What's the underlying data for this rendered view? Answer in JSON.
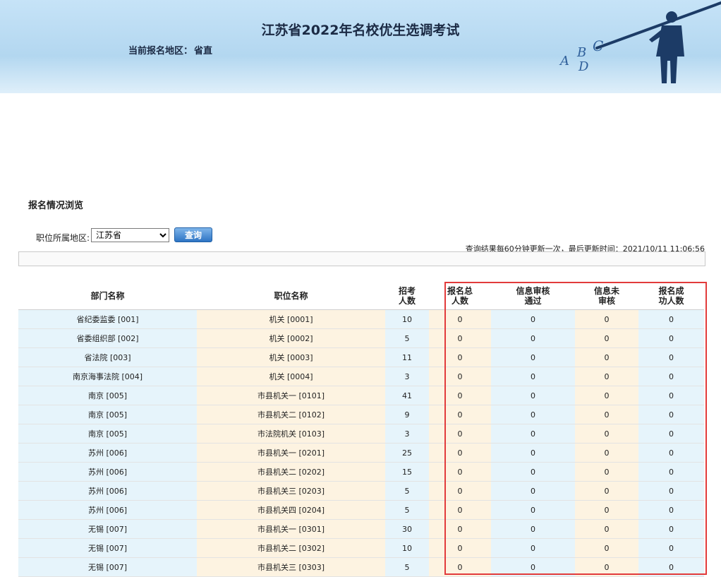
{
  "header": {
    "title": "江苏省2022年名校优生选调考试",
    "region_label": "当前报名地区：",
    "region_value": "省直",
    "art_letters": "A B C D"
  },
  "section_title": "报名情况浏览",
  "filter": {
    "label": "职位所属地区:",
    "selected_value": "江苏省",
    "query_button": "查询"
  },
  "update_note": "查询结果每60分钟更新一次，最后更新时间：2021/10/11 11:06:56",
  "table": {
    "headers": [
      "部门名称",
      "职位名称",
      "招考人数",
      "报名总人数",
      "信息审核通过",
      "信息未审核",
      "报名成功人数"
    ],
    "rows": [
      {
        "dept": "省纪委监委 [001]",
        "position": "机关 [0001]",
        "quota": "10",
        "total": "0",
        "passed": "0",
        "unreviewed": "0",
        "success": "0"
      },
      {
        "dept": "省委组织部 [002]",
        "position": "机关 [0002]",
        "quota": "5",
        "total": "0",
        "passed": "0",
        "unreviewed": "0",
        "success": "0"
      },
      {
        "dept": "省法院 [003]",
        "position": "机关 [0003]",
        "quota": "11",
        "total": "0",
        "passed": "0",
        "unreviewed": "0",
        "success": "0"
      },
      {
        "dept": "南京海事法院 [004]",
        "position": "机关 [0004]",
        "quota": "3",
        "total": "0",
        "passed": "0",
        "unreviewed": "0",
        "success": "0"
      },
      {
        "dept": "南京 [005]",
        "position": "市县机关一 [0101]",
        "quota": "41",
        "total": "0",
        "passed": "0",
        "unreviewed": "0",
        "success": "0"
      },
      {
        "dept": "南京 [005]",
        "position": "市县机关二 [0102]",
        "quota": "9",
        "total": "0",
        "passed": "0",
        "unreviewed": "0",
        "success": "0"
      },
      {
        "dept": "南京 [005]",
        "position": "市法院机关 [0103]",
        "quota": "3",
        "total": "0",
        "passed": "0",
        "unreviewed": "0",
        "success": "0"
      },
      {
        "dept": "苏州 [006]",
        "position": "市县机关一 [0201]",
        "quota": "25",
        "total": "0",
        "passed": "0",
        "unreviewed": "0",
        "success": "0"
      },
      {
        "dept": "苏州 [006]",
        "position": "市县机关二 [0202]",
        "quota": "15",
        "total": "0",
        "passed": "0",
        "unreviewed": "0",
        "success": "0"
      },
      {
        "dept": "苏州 [006]",
        "position": "市县机关三 [0203]",
        "quota": "5",
        "total": "0",
        "passed": "0",
        "unreviewed": "0",
        "success": "0"
      },
      {
        "dept": "苏州 [006]",
        "position": "市县机关四 [0204]",
        "quota": "5",
        "total": "0",
        "passed": "0",
        "unreviewed": "0",
        "success": "0"
      },
      {
        "dept": "无锡 [007]",
        "position": "市县机关一 [0301]",
        "quota": "30",
        "total": "0",
        "passed": "0",
        "unreviewed": "0",
        "success": "0"
      },
      {
        "dept": "无锡 [007]",
        "position": "市县机关二 [0302]",
        "quota": "10",
        "total": "0",
        "passed": "0",
        "unreviewed": "0",
        "success": "0"
      },
      {
        "dept": "无锡 [007]",
        "position": "市县机关三 [0303]",
        "quota": "5",
        "total": "0",
        "passed": "0",
        "unreviewed": "0",
        "success": "0"
      }
    ]
  },
  "colors": {
    "header_bg": "#b3d7f0",
    "col_blue": "#e6f4fb",
    "col_cream": "#fdf3e1",
    "highlight_border": "#e23b3b",
    "button": "#2e74c4"
  }
}
